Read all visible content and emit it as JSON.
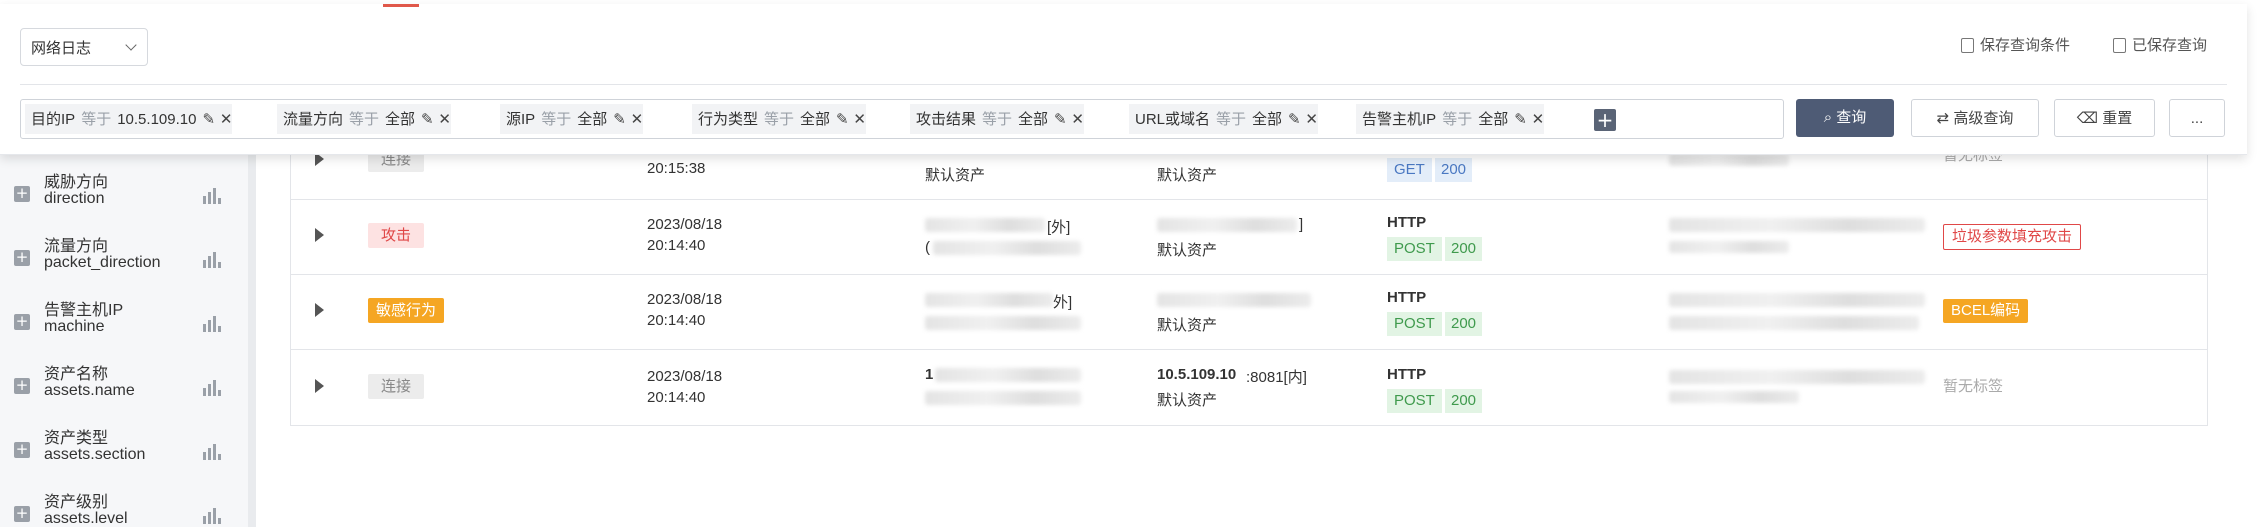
{
  "query_panel": {
    "log_type": "网络日志",
    "save_query": "保存查询条件",
    "saved_queries": "已保存查询",
    "filters": [
      {
        "field": "目的IP",
        "op": "等于",
        "value": "10.5.109.10"
      },
      {
        "field": "流量方向",
        "op": "等于",
        "value": "全部"
      },
      {
        "field": "源IP",
        "op": "等于",
        "value": "全部"
      },
      {
        "field": "行为类型",
        "op": "等于",
        "value": "全部"
      },
      {
        "field": "攻击结果",
        "op": "等于",
        "value": "全部"
      },
      {
        "field": "URL或域名",
        "op": "等于",
        "value": "全部"
      },
      {
        "field": "告警主机IP",
        "op": "等于",
        "value": "全部"
      }
    ],
    "add_symbol": "+",
    "search_label": "查询",
    "advanced_label": "高级查询",
    "reset_label": "重置",
    "more_label": "..."
  },
  "sidebar": {
    "facets": [
      {
        "zh": "威胁方向",
        "en": "direction"
      },
      {
        "zh": "流量方向",
        "en": "packet_direction"
      },
      {
        "zh": "告警主机IP",
        "en": "machine"
      },
      {
        "zh": "资产名称",
        "en": "assets.name"
      },
      {
        "zh": "资产类型",
        "en": "assets.section"
      },
      {
        "zh": "资产级别",
        "en": "assets.level"
      }
    ]
  },
  "table": {
    "rows": [
      {
        "type": "连接",
        "type_style": "conn",
        "date": "",
        "time": "20:15:38",
        "src_line2": "默认资产",
        "dst_line1": "",
        "dst_line2": "默认资产",
        "protocol": "",
        "method": "GET",
        "status": "200",
        "label": "暂无标签",
        "label_style": "none"
      },
      {
        "type": "攻击",
        "type_style": "attack",
        "date": "2023/08/18",
        "time": "20:14:40",
        "src_line1_suffix": "[外]",
        "src_line2_prefix": "(",
        "dst_line1_suffix": "]",
        "dst_line2": "默认资产",
        "protocol": "HTTP",
        "method": "POST",
        "status": "200",
        "label": "垃圾参数填充攻击",
        "label_style": "red"
      },
      {
        "type": "敏感行为",
        "type_style": "sens",
        "date": "2023/08/18",
        "time": "20:14:40",
        "src_line1_suffix": "外]",
        "dst_line2": "默认资产",
        "protocol": "HTTP",
        "method": "POST",
        "status": "200",
        "label": "BCEL编码",
        "label_style": "orange"
      },
      {
        "type": "连接",
        "type_style": "conn",
        "date": "2023/08/18",
        "time": "20:14:40",
        "src_line1_prefix": "1",
        "dst_ip": "10.5.109.10",
        "dst_port": ":8081[内]",
        "dst_line2": "默认资产",
        "protocol": "HTTP",
        "method": "POST",
        "status": "200",
        "label": "暂无标签",
        "label_style": "none"
      }
    ]
  },
  "colors": {
    "primary_button": "#4e5b75",
    "attack_tag": "#e04848",
    "sensitive_tag": "#f5a623",
    "get_badge": "#4a78c2",
    "post_badge": "#3f9a4d"
  }
}
